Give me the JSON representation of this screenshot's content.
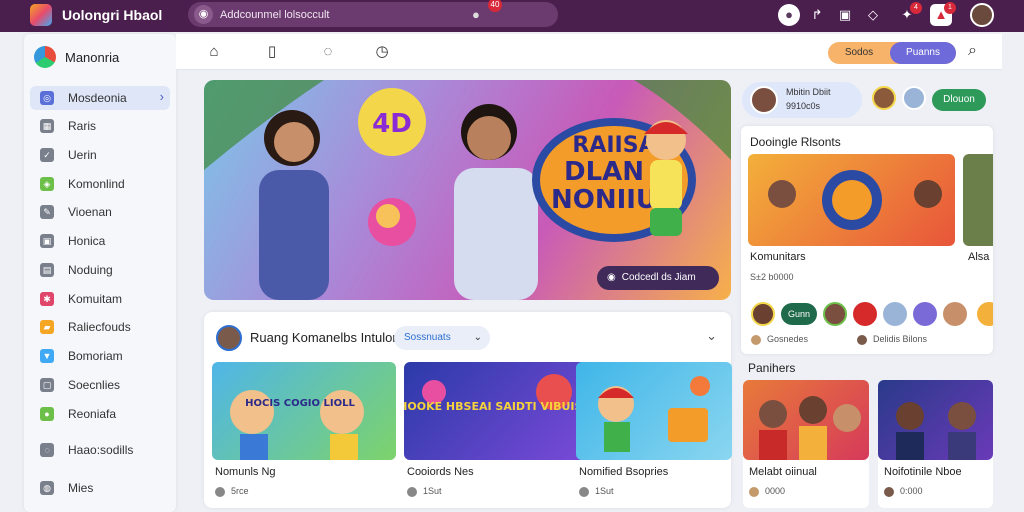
{
  "app": {
    "title": "Uolongri Hbaol"
  },
  "search": {
    "placeholder": "Addcounmel lolsoccult",
    "mic_badge": "40"
  },
  "topbar_icons": [
    {
      "name": "profile-circle-icon"
    },
    {
      "name": "arrow-icon"
    },
    {
      "name": "tablet-icon"
    },
    {
      "name": "location-pin-icon"
    },
    {
      "name": "apps-icon",
      "badge": "4"
    },
    {
      "name": "notifications-icon",
      "badge": "1"
    },
    {
      "name": "user-avatar"
    }
  ],
  "sidebar": {
    "header": "Manonria",
    "items": [
      {
        "label": "Mosdeonia",
        "icon": "home-icon",
        "color": "#5a6fd8",
        "active": true
      },
      {
        "label": "Raris",
        "icon": "grid-icon",
        "color": "#7a7f8c"
      },
      {
        "label": "Uerin",
        "icon": "check-icon",
        "color": "#7a7f8c"
      },
      {
        "label": "Komonlind",
        "icon": "shield-icon",
        "color": "#6cc04a"
      },
      {
        "label": "Vioenan",
        "icon": "edit-icon",
        "color": "#7a7f8c"
      },
      {
        "label": "Honica",
        "icon": "image-icon",
        "color": "#7a7f8c"
      },
      {
        "label": "Noduing",
        "icon": "chart-icon",
        "color": "#7a7f8c"
      },
      {
        "label": "Komuitam",
        "icon": "pinwheel-icon",
        "color": "#e0466a"
      },
      {
        "label": "Raliecfouds",
        "icon": "folder-icon",
        "color": "#f5a623"
      },
      {
        "label": "Bomoriam",
        "icon": "triangle-icon",
        "color": "#3fa9f5"
      },
      {
        "label": "Soecnlies",
        "icon": "box-icon",
        "color": "#7a7f8c"
      },
      {
        "label": "Reoniafa",
        "icon": "globe-icon",
        "color": "#6cc04a"
      },
      {
        "label": "Haao:sodills",
        "icon": "settings-icon",
        "color": "#7a7f8c"
      },
      {
        "label": "Mies",
        "icon": "people-icon",
        "color": "#7a7f8c"
      }
    ]
  },
  "tabs": [
    {
      "name": "home-tab-icon",
      "glyph": "⌂"
    },
    {
      "name": "tablet-tab-icon",
      "glyph": "▯"
    },
    {
      "name": "chat-tab-icon",
      "glyph": "◌"
    },
    {
      "name": "clock-tab-icon",
      "glyph": "◷"
    }
  ],
  "tab_toggle": {
    "left": "Sodos",
    "right": "Puanns"
  },
  "hero": {
    "title_lines": [
      "4D",
      "RAIISA",
      "DLAN",
      "NONIIU"
    ],
    "cta": "Codcedl ds Jiam"
  },
  "recommended": {
    "title": "Ruang Komanelbs Intulor",
    "chip": "Sossnuats",
    "videos": [
      {
        "title": "Nomunls Ng",
        "meta": "5rce",
        "overlay": "HOCIS COGIO LIOLL"
      },
      {
        "title": "Cooiords Nes",
        "meta": "1Sut",
        "overlay": "HOOKE HBSEAI SAIDTI VIBUISS"
      },
      {
        "title": "Nomified  Bsopries",
        "meta": "1Sut",
        "overlay": ""
      }
    ]
  },
  "right_panel": {
    "user": {
      "name": "Mbitin Dbiit",
      "sub": "9910c0s"
    },
    "follow_label": "Dlouon",
    "channels_title": "Dooingle Rlsonts",
    "channels": [
      {
        "name": "Komunitars",
        "sub": "S±2 b0000"
      },
      {
        "name": "Alsa",
        "sub": ""
      }
    ],
    "follow_small": "Gunn",
    "footer_left": "Gosnedes",
    "footer_right": "Delidis Bilons",
    "playlists_title": "Panihers",
    "playlists": [
      {
        "name": "Melabt oiinual",
        "meta": "0000"
      },
      {
        "name": "Noifotinile Nboe",
        "meta": "0:000"
      }
    ]
  },
  "colors": {
    "topbar": "#4a1f4e",
    "accent": "#5a6fd8",
    "follow_green": "#2e9a5a"
  }
}
